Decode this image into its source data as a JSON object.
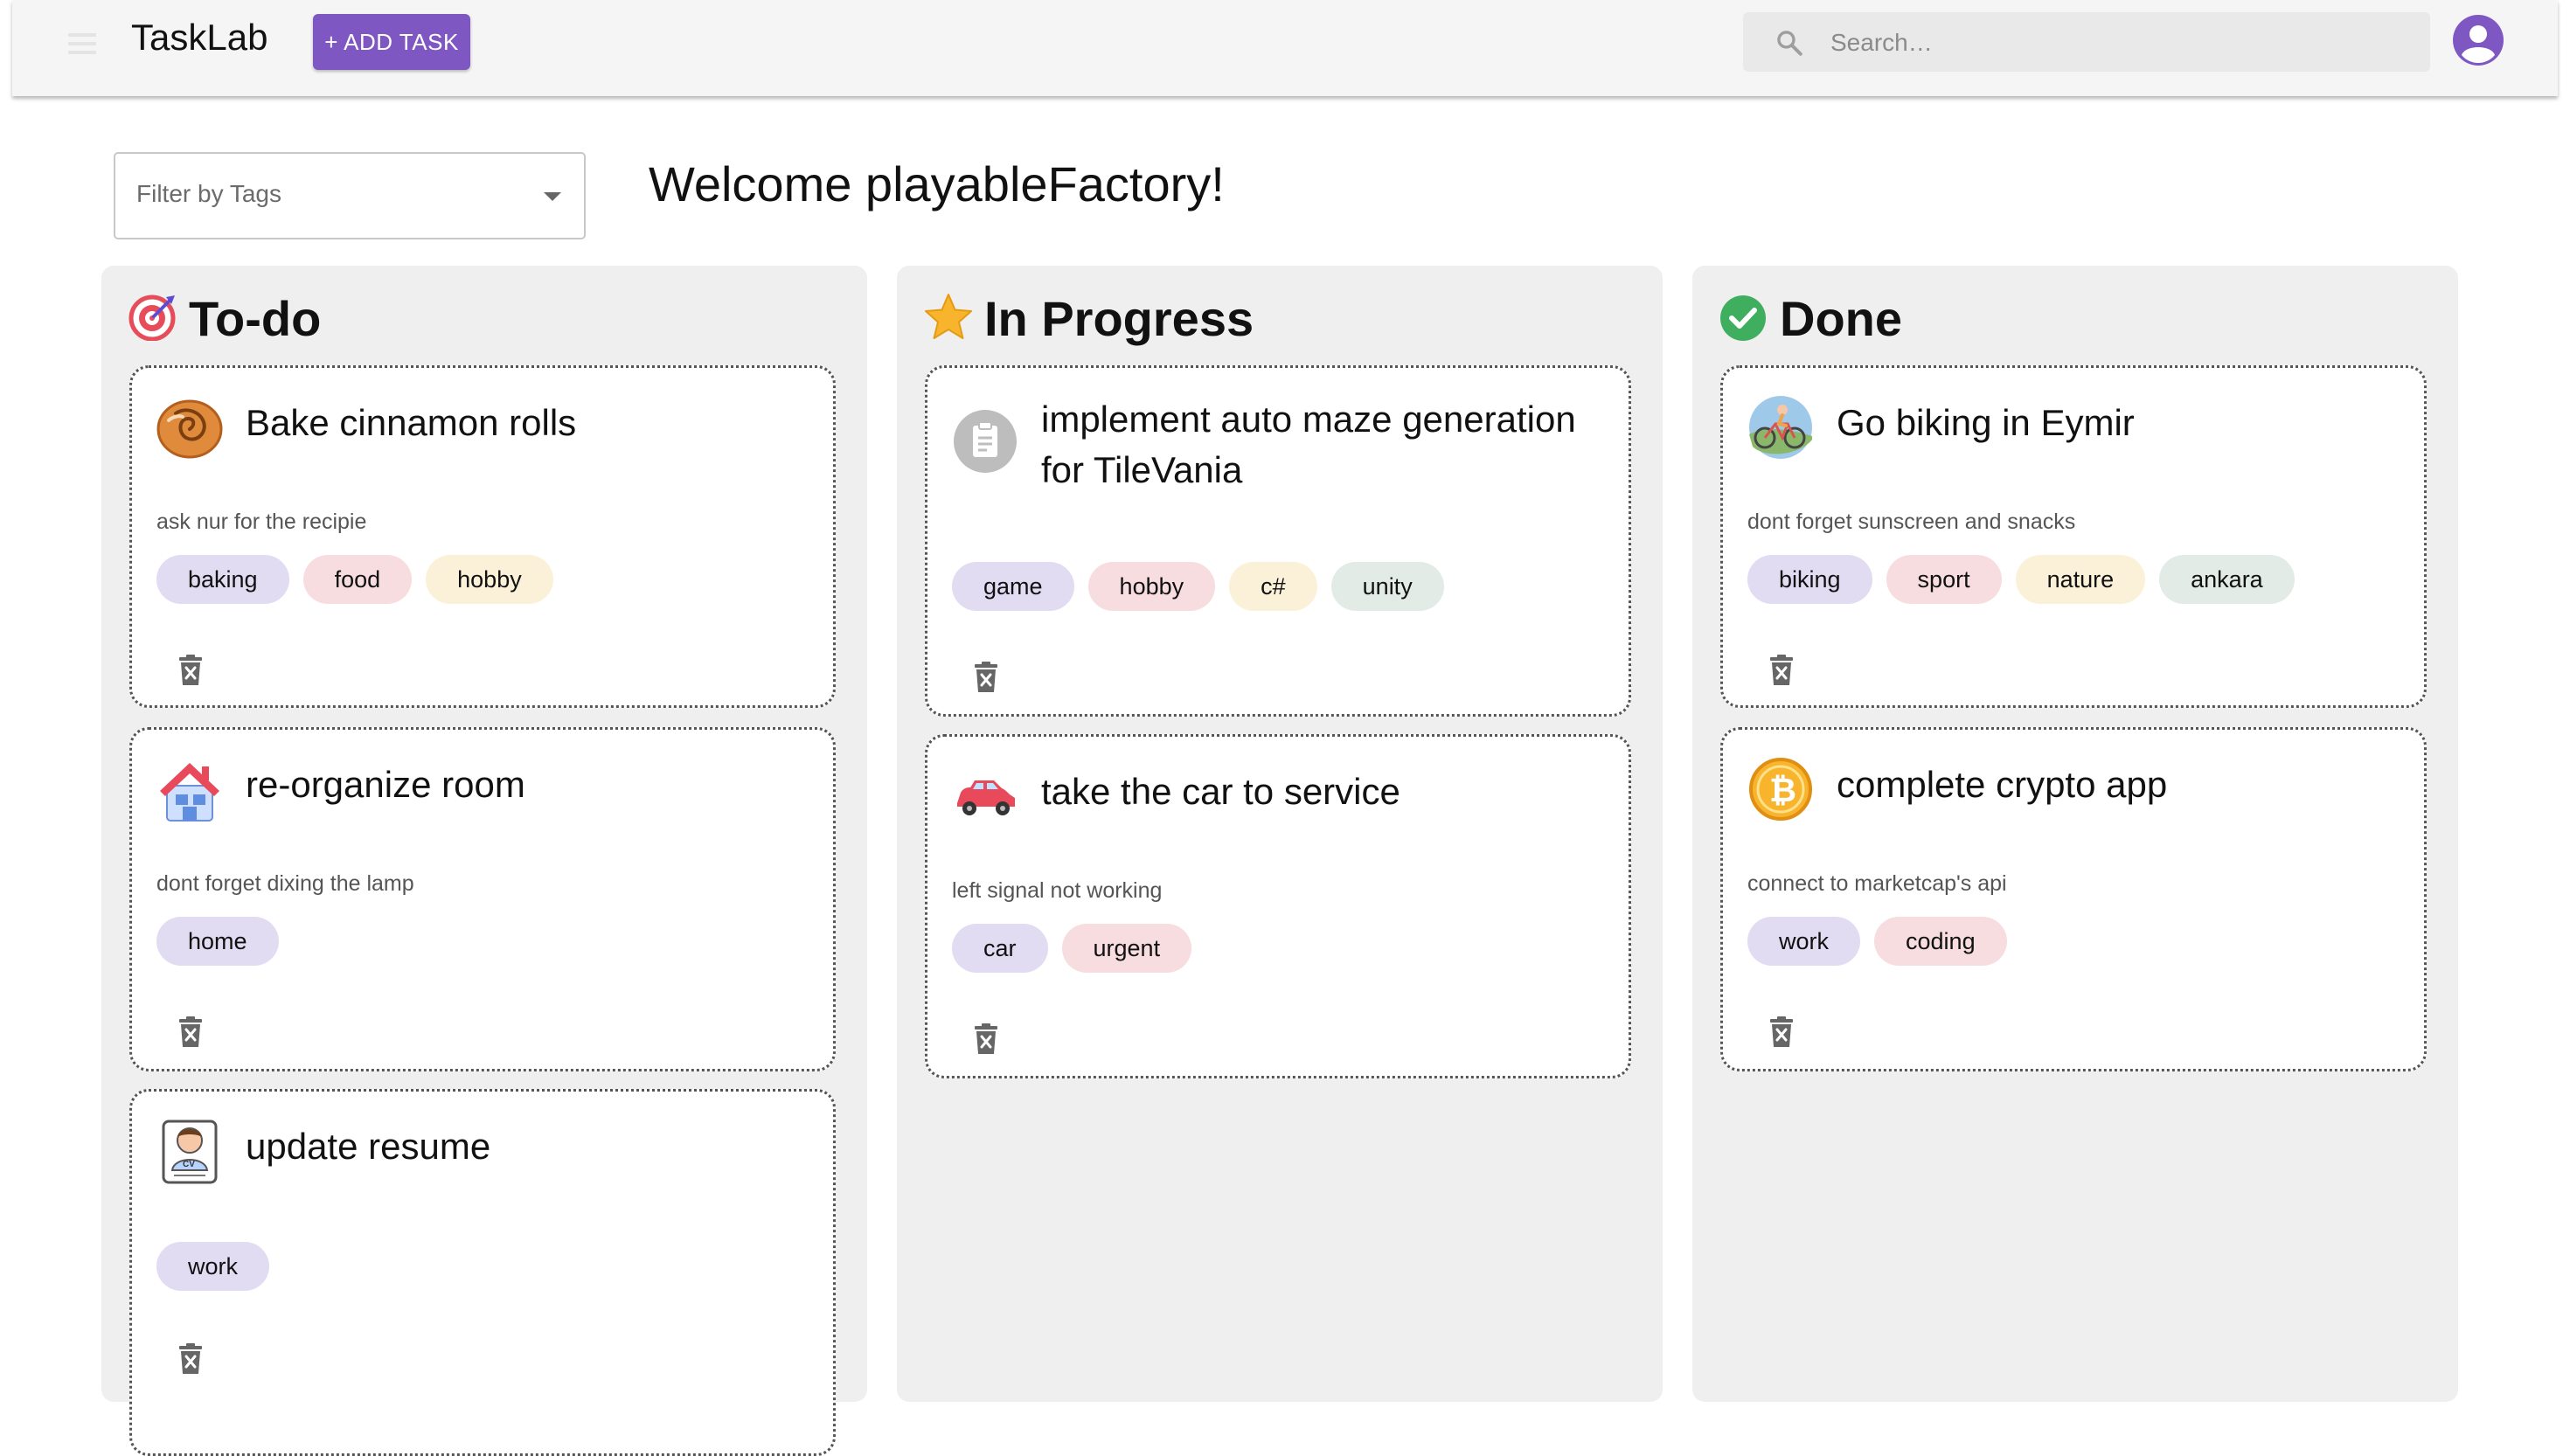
{
  "app": {
    "title": "TaskLab",
    "add_task_label": "+ ADD TASK",
    "search_placeholder": "Search…"
  },
  "filter": {
    "label": "Filter by Tags"
  },
  "welcome": "Welcome playableFactory!",
  "columns": [
    {
      "title": "To-do",
      "icon": "target-icon",
      "cards": [
        {
          "title": "Bake cinnamon rolls",
          "icon": "cinnamon-roll-icon",
          "desc": "ask nur for the recipie",
          "tags": [
            "baking",
            "food",
            "hobby"
          ]
        },
        {
          "title": "re-organize room",
          "icon": "house-icon",
          "desc": "dont forget dixing the lamp",
          "tags": [
            "home"
          ]
        },
        {
          "title": "update resume",
          "icon": "cv-icon",
          "desc": "",
          "tags": [
            "work"
          ]
        }
      ]
    },
    {
      "title": "In Progress",
      "icon": "star-icon",
      "cards": [
        {
          "title_line1": "implement auto maze generation",
          "title_line2": "for TileVania",
          "icon": "clipboard-icon",
          "desc": "",
          "tags": [
            "game",
            "hobby",
            "c#",
            "unity"
          ]
        },
        {
          "title": "take the car to service",
          "icon": "car-icon",
          "desc": "left signal not working",
          "tags": [
            "car",
            "urgent"
          ]
        }
      ]
    },
    {
      "title": "Done",
      "icon": "check-circle-icon",
      "cards": [
        {
          "title": "Go biking in Eymir",
          "icon": "biking-icon",
          "desc": "dont forget sunscreen and snacks",
          "tags": [
            "biking",
            "sport",
            "nature",
            "ankara"
          ]
        },
        {
          "title": "complete crypto app",
          "icon": "bitcoin-icon",
          "desc": "connect to marketcap's api",
          "tags": [
            "work",
            "coding"
          ]
        }
      ]
    }
  ],
  "colors": {
    "accent": "#7e57c2",
    "tag_purple": "#e2dcf3",
    "tag_pink": "#f7dddf",
    "tag_yellow": "#fbf1d8",
    "tag_green": "#e2ebe6",
    "column_bg": "#efefef"
  }
}
